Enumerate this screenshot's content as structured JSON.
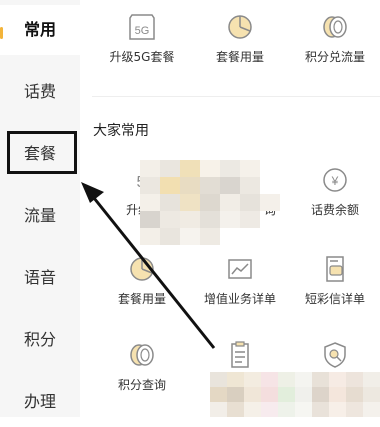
{
  "sidebar": {
    "items": [
      {
        "label": "常用",
        "active": true
      },
      {
        "label": "话费"
      },
      {
        "label": "套餐"
      },
      {
        "label": "流量"
      },
      {
        "label": "语音"
      },
      {
        "label": "积分"
      },
      {
        "label": "办理"
      }
    ]
  },
  "top_row": [
    {
      "label": "升级5G套餐",
      "icon": "5g-icon"
    },
    {
      "label": "套餐用量",
      "icon": "pie-chart-icon"
    },
    {
      "label": "积分兑流量",
      "icon": "coins-icon"
    }
  ],
  "section": {
    "title": "大家常用",
    "row1": [
      {
        "label": "升级5",
        "icon": "5g-icon"
      },
      {
        "label": "询",
        "icon": "blurred-icon"
      },
      {
        "label": "话费余额",
        "icon": "yen-coin-icon"
      }
    ],
    "row2": [
      {
        "label": "套餐用量",
        "icon": "pie-chart-icon"
      },
      {
        "label": "增值业务详单",
        "icon": "chart-icon"
      },
      {
        "label": "短彩信详单",
        "icon": "message-doc-icon"
      }
    ],
    "row3": [
      {
        "label": "积分查询",
        "icon": "coins-icon"
      },
      {
        "label": "",
        "icon": "document-list-icon"
      },
      {
        "label": "",
        "icon": "shield-search-icon"
      }
    ]
  },
  "colors": {
    "accent": "#f3b43a",
    "sidebar_bg": "#f6f6f6",
    "icon_stroke": "#8a8a8a",
    "icon_fill": "#f6e2b0"
  }
}
